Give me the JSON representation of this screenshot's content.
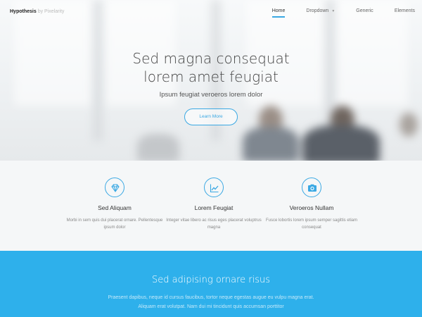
{
  "header": {
    "logo_name": "Hypothesis",
    "logo_by": "by Pixelarity",
    "nav": [
      {
        "label": "Home",
        "active": true
      },
      {
        "label": "Dropdown",
        "has_caret": true
      },
      {
        "label": "Generic"
      },
      {
        "label": "Elements"
      }
    ]
  },
  "hero": {
    "title_line1": "Sed magna consequat",
    "title_line2": "lorem amet feugiat",
    "subtitle": "Ipsum feugiat veroeros lorem dolor",
    "cta_label": "Learn More"
  },
  "features": [
    {
      "icon": "diamond-icon",
      "title": "Sed Aliquam",
      "text": "Morbi in sem quis dui placerat ornare. Pellentesque ipsum dolor"
    },
    {
      "icon": "line-chart-icon",
      "title": "Lorem Feugiat",
      "text": "Integer vitae libero ac risus eges placerat voluptrus magna"
    },
    {
      "icon": "camera-icon",
      "title": "Veroeros Nullam",
      "text": "Fusce lobortis lorem ipsum semper sagittis etiam consequat"
    }
  ],
  "promo": {
    "title": "Sed adipising ornare risus",
    "text": "Praesent dapibus, neque id cursus faucibus, tortor neque egestas augue eu vulpu magna erat. Aliquam erat volutpat. Nam dui mi tincidunt quis accumsan porttitor"
  },
  "colors": {
    "accent": "#3aa8e3",
    "promo_background": "#2eb0eb"
  }
}
